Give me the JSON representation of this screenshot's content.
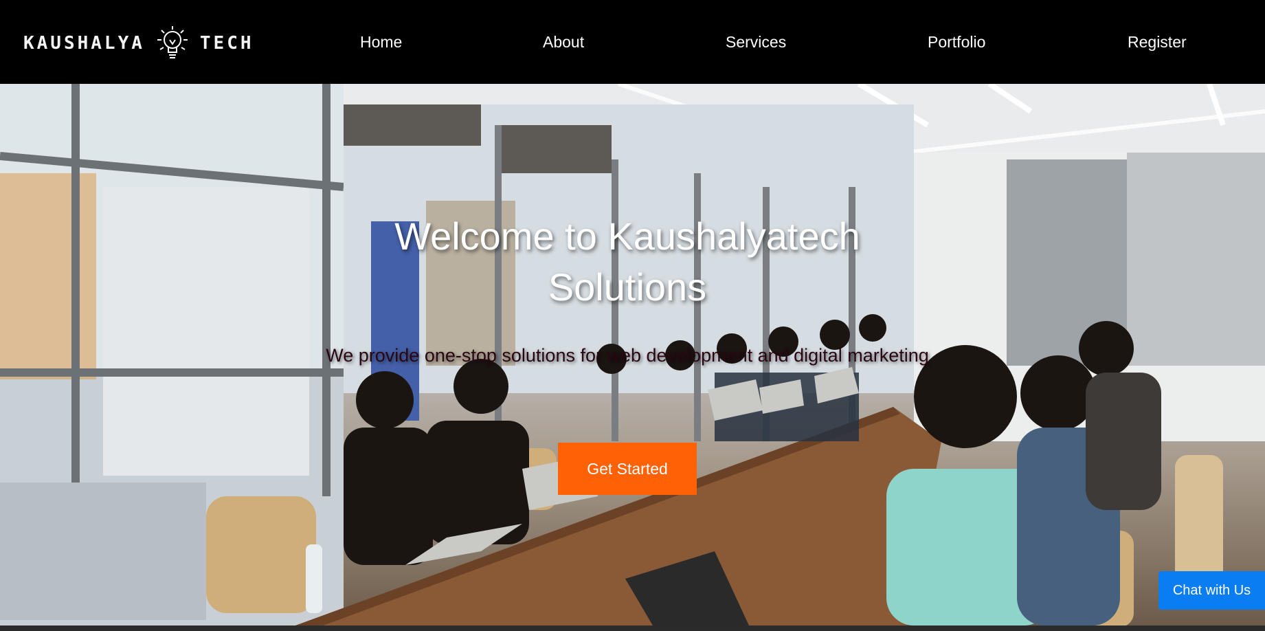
{
  "header": {
    "logo": {
      "left_text": "KAUSHALYA",
      "right_text": "TECH",
      "icon": "lightbulb-icon"
    },
    "nav": [
      {
        "label": "Home"
      },
      {
        "label": "About"
      },
      {
        "label": "Services"
      },
      {
        "label": "Portfolio"
      },
      {
        "label": "Register"
      }
    ]
  },
  "hero": {
    "title": "Welcome to Kaushalyatech Solutions",
    "subtitle": "We provide one-stop solutions for web development and digital marketing",
    "cta_label": "Get Started",
    "background": "office meeting photo"
  },
  "chat": {
    "label": "Chat with Us"
  },
  "colors": {
    "accent": "#ff6106",
    "chat": "#0a7df2",
    "header_bg": "#000000",
    "subtitle": "#2a0612"
  }
}
